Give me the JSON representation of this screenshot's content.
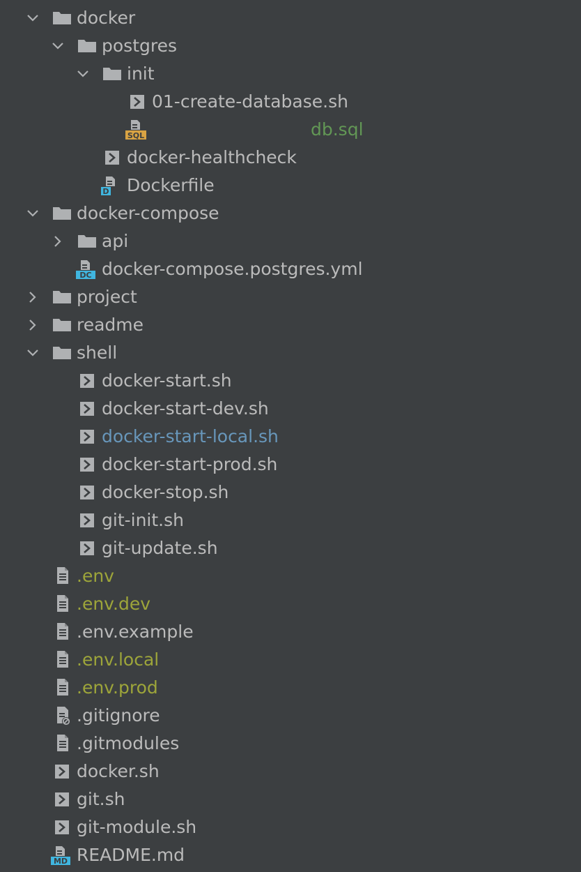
{
  "tree": [
    {
      "label": "docker",
      "kind": "folder",
      "depth": 0,
      "expanded": true
    },
    {
      "label": "postgres",
      "kind": "folder",
      "depth": 1,
      "expanded": true
    },
    {
      "label": "init",
      "kind": "folder",
      "depth": 2,
      "expanded": true
    },
    {
      "label": "01-create-database.sh",
      "kind": "shell",
      "depth": 3
    },
    {
      "label": "db.sql",
      "kind": "sql",
      "depth": 3,
      "color": "green",
      "icon_badge": "SQL"
    },
    {
      "label": "docker-healthcheck",
      "kind": "shell",
      "depth": 2
    },
    {
      "label": "Dockerfile",
      "kind": "dockerfile",
      "depth": 2,
      "icon_badge": "D"
    },
    {
      "label": "docker-compose",
      "kind": "folder",
      "depth": 0,
      "expanded": true
    },
    {
      "label": "api",
      "kind": "folder",
      "depth": 1,
      "expanded": false
    },
    {
      "label": "docker-compose.postgres.yml",
      "kind": "compose",
      "depth": 1,
      "icon_badge": "DC"
    },
    {
      "label": "project",
      "kind": "folder",
      "depth": 0,
      "expanded": false
    },
    {
      "label": "readme",
      "kind": "folder",
      "depth": 0,
      "expanded": false
    },
    {
      "label": "shell",
      "kind": "folder",
      "depth": 0,
      "expanded": true
    },
    {
      "label": "docker-start.sh",
      "kind": "shell",
      "depth": 1
    },
    {
      "label": "docker-start-dev.sh",
      "kind": "shell",
      "depth": 1
    },
    {
      "label": "docker-start-local.sh",
      "kind": "shell",
      "depth": 1,
      "color": "blue"
    },
    {
      "label": "docker-start-prod.sh",
      "kind": "shell",
      "depth": 1
    },
    {
      "label": "docker-stop.sh",
      "kind": "shell",
      "depth": 1
    },
    {
      "label": "git-init.sh",
      "kind": "shell",
      "depth": 1
    },
    {
      "label": "git-update.sh",
      "kind": "shell",
      "depth": 1
    },
    {
      "label": ".env",
      "kind": "text",
      "depth": 0,
      "color": "olive"
    },
    {
      "label": ".env.dev",
      "kind": "text",
      "depth": 0,
      "color": "olive"
    },
    {
      "label": ".env.example",
      "kind": "text",
      "depth": 0
    },
    {
      "label": ".env.local",
      "kind": "text",
      "depth": 0,
      "color": "olive"
    },
    {
      "label": ".env.prod",
      "kind": "text",
      "depth": 0,
      "color": "olive"
    },
    {
      "label": ".gitignore",
      "kind": "ignore",
      "depth": 0
    },
    {
      "label": ".gitmodules",
      "kind": "text",
      "depth": 0
    },
    {
      "label": "docker.sh",
      "kind": "shell",
      "depth": 0
    },
    {
      "label": "git.sh",
      "kind": "shell",
      "depth": 0
    },
    {
      "label": "git-module.sh",
      "kind": "shell",
      "depth": 0
    },
    {
      "label": "README.md",
      "kind": "markdown",
      "depth": 0,
      "icon_badge": "MD"
    }
  ],
  "colors": {
    "background": "#3c3f41",
    "text": "#bbbbbb",
    "olive": "#9da53a",
    "green": "#629755",
    "blue": "#6897bb",
    "icon_gray": "#afb1b3",
    "icon_dark": "#3c3f41",
    "badge_blue": "#40b6e0",
    "badge_sql": "#d9a343"
  }
}
